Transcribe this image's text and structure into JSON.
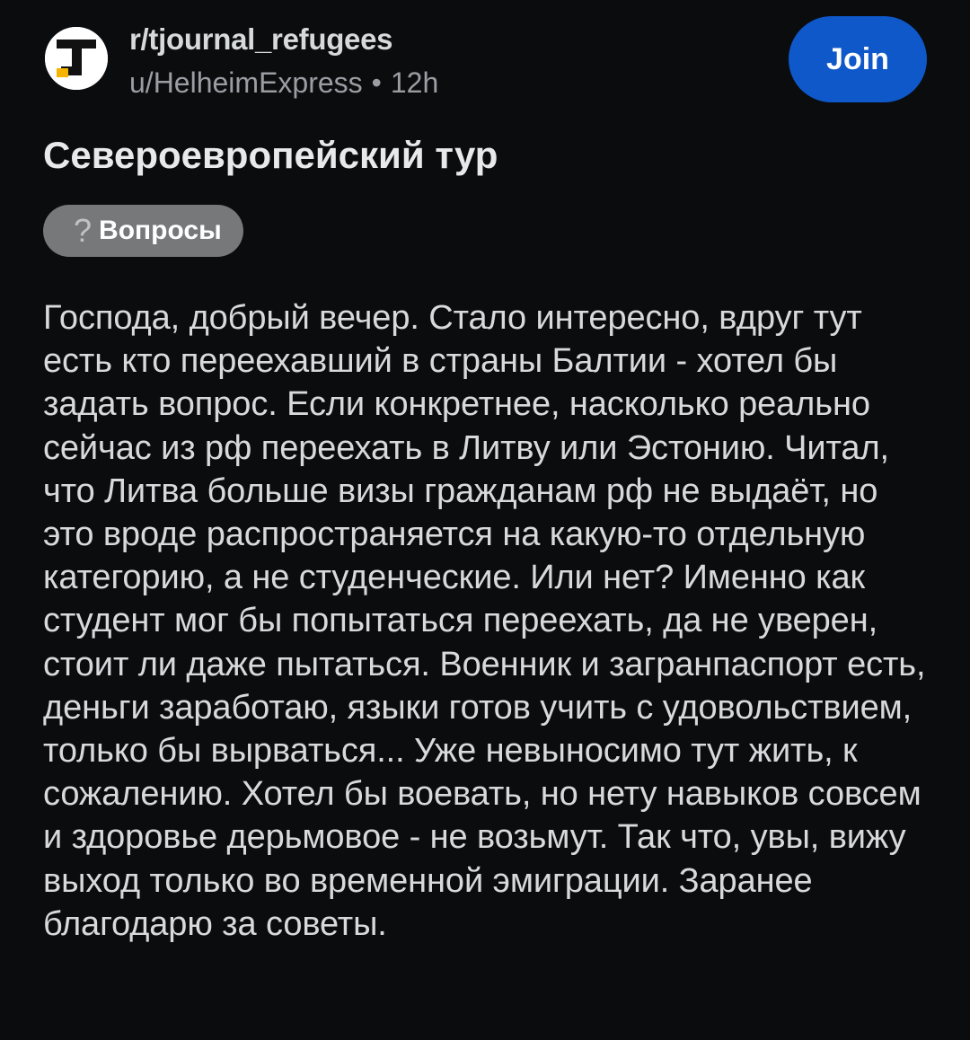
{
  "post": {
    "subreddit": "r/tjournal_refugees",
    "author": "u/HelheimExpress",
    "separator": "•",
    "age": "12h",
    "join_label": "Join",
    "title": "Североевропейский тур",
    "flair": {
      "icon": "question-icon",
      "icon_glyph": "?",
      "label": "Вопросы"
    },
    "body": "Господа, добрый вечер. Стало интересно, вдруг тут есть кто переехавший в страны Балтии - хотел бы задать вопрос. Если конкретнее, насколько реально сейчас из рф переехать в Литву или Эстонию. Читал, что Литва больше визы гражданам рф не выдаёт, но это вроде распространяется на какую-то отдельную категорию, а не студенческие. Или нет? Именно как студент мог бы попытаться переехать, да не уверен, стоит ли даже пытаться. Военник и загранпаспорт есть, деньги заработаю, языки готов учить с удовольствием, только бы вырваться... Уже невыносимо тут жить, к сожалению. Хотел бы воевать, но нету навыков совсем и здоровье дерьмовое - не возьмут. Так что, увы, вижу выход только во временной эмиграции. Заранее благодарю за советы."
  },
  "colors": {
    "background": "#0b0c0e",
    "join_button": "#0f58c9",
    "flair_background": "#76787a",
    "text_primary": "#d7dadc",
    "text_muted": "#9a9ea3",
    "logo_accent": "#f5b400"
  }
}
